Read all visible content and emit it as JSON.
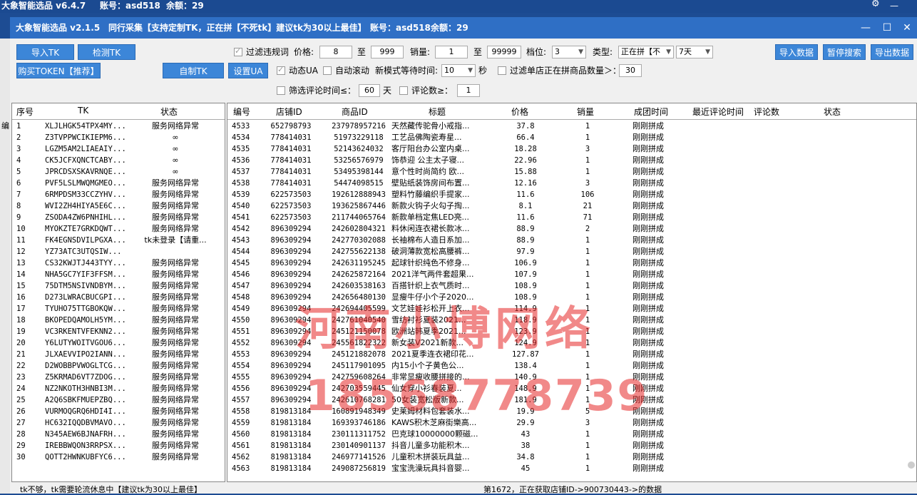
{
  "outer_title": {
    "app": "大象智能选品 v6.4.7",
    "account": "账号：asd518",
    "balance": "余额：29"
  },
  "inner_title": {
    "app": "大象智能选品 v2.1.5",
    "mode": "同行采集【支持定制TK，正在拼【不死tk】建议tk为30以上最佳】",
    "account": "账号：asd518",
    "balance": "余额：29"
  },
  "left_edge_text": "编",
  "buttons": {
    "import_tk": "导入TK",
    "check_tk": "检测TK",
    "buy_token": "购买TOKEN【推荐】",
    "custom_tk": "自制TK",
    "set_ua": "设置UA",
    "import_data": "导入数据",
    "pause_search": "暂停搜索",
    "export_data": "导出数据"
  },
  "filters": {
    "filter_banned": "过滤违规词",
    "price_label": "价格:",
    "price_min": "8",
    "to1": "至",
    "price_max": "999",
    "sales_label": "销量:",
    "sales_min": "1",
    "to2": "至",
    "sales_max": "99999",
    "tier_label": "档位:",
    "tier_value": "3",
    "type_label": "类型:",
    "type_value": "正在拼【不",
    "days_value": "7天",
    "dynamic_ua": "动态UA",
    "auto_scroll": "自动滚动",
    "wait_label": "新模式等待时间:",
    "wait_value": "10",
    "wait_unit": "秒",
    "filter_store": "过滤单店正在拼商品数量＞：",
    "store_count": "30",
    "filter_review_time": "筛选评论时间≤：",
    "review_days": "60",
    "day_unit": "天",
    "review_count_label": "评论数≥：",
    "review_count": "1"
  },
  "tk_table": {
    "headers": [
      "序号",
      "TK",
      "状态"
    ],
    "rows": [
      [
        "1",
        "XLJLHGK54TPX4MY...",
        "服务网络异常"
      ],
      [
        "2",
        "Z3TVPPWCIKIEPM6...",
        "∞"
      ],
      [
        "3",
        "LGZM5AM2LIAEAIY...",
        "∞"
      ],
      [
        "4",
        "CK5JCFXQNCTCABY...",
        "∞"
      ],
      [
        "5",
        "JPRCDSXSKAVRNQE...",
        "∞"
      ],
      [
        "6",
        "PVF5LSLMWQMGMEO...",
        "服务网络异常"
      ],
      [
        "7",
        "6RMPDSM33CCZYHV...",
        "服务网络异常"
      ],
      [
        "8",
        "WVI2ZH4HIYA5E6C...",
        "服务网络异常"
      ],
      [
        "9",
        "ZSODA4ZW6PNHIHL...",
        "服务网络异常"
      ],
      [
        "10",
        "MYOKZTE7GRKDQWT...",
        "服务网络异常"
      ],
      [
        "11",
        "FK4EGNSDVILPGXA...",
        "tk未登录【请重..."
      ],
      [
        "12",
        "YZ73ATC3UTQSIW...",
        ""
      ],
      [
        "13",
        "CS32KWJTJ443TYY...",
        "服务网络异常"
      ],
      [
        "14",
        "NHA5GC7YIF3FFSM...",
        "服务网络异常"
      ],
      [
        "15",
        "75DTM5NSIVNDBYM...",
        "服务网络异常"
      ],
      [
        "16",
        "D273LWRACBUCGPI...",
        "服务网络异常"
      ],
      [
        "17",
        "TYUHO75TTGBOKQW...",
        "服务网络异常"
      ],
      [
        "18",
        "BKOPEDQAMOLH5YM...",
        "服务网络异常"
      ],
      [
        "19",
        "VC3RKENTVFEKNN2...",
        "服务网络异常"
      ],
      [
        "20",
        "Y6LUTYWOITVGOU6...",
        "服务网络异常"
      ],
      [
        "21",
        "JLXAEVVIPO2IANN...",
        "服务网络异常"
      ],
      [
        "22",
        "D2WOBBPVWOGLTCG...",
        "服务网络异常"
      ],
      [
        "23",
        "Z5KRMAD6VT7ZDOG...",
        "服务网络异常"
      ],
      [
        "24",
        "NZ2NKOTH3HNBI3M...",
        "服务网络异常"
      ],
      [
        "25",
        "A2Q6SBKFMUEPZBQ...",
        "服务网络异常"
      ],
      [
        "26",
        "VURMOQGRQ6HDI4I...",
        "服务网络异常"
      ],
      [
        "27",
        "HC632IQQDBVMAVO...",
        "服务网络异常"
      ],
      [
        "28",
        "N345AEW6BJNAFRH...",
        "服务网络异常"
      ],
      [
        "29",
        "IREBBWQON3RRPSX...",
        "服务网络异常"
      ],
      [
        "30",
        "QOTT2HWNKUBFYC6...",
        "服务网络异常"
      ]
    ]
  },
  "goods_table": {
    "headers": [
      "编号",
      "店铺ID",
      "商品ID",
      "标题",
      "价格",
      "销量",
      "成团时间",
      "最近评论时间",
      "评论数",
      "状态"
    ],
    "rows": [
      [
        "4533",
        "652798793",
        "237978957216",
        "天然藏传驼骨小戒指...",
        "37.8",
        "1",
        "刚刚拼成"
      ],
      [
        "4534",
        "778414031",
        "51973229118",
        "工艺品佛陶瓷寿星...",
        "66.4",
        "1",
        "刚刚拼成"
      ],
      [
        "4535",
        "778414031",
        "52143624032",
        "客厅阳台办公室内桌...",
        "18.28",
        "3",
        "刚刚拼成"
      ],
      [
        "4536",
        "778414031",
        "53256576979",
        "饰恭迎 公主太子寝...",
        "22.96",
        "1",
        "刚刚拼成"
      ],
      [
        "4537",
        "778414031",
        "53495398144",
        "意个性时尚简约 欧...",
        "15.88",
        "1",
        "刚刚拼成"
      ],
      [
        "4538",
        "778414031",
        "54474098515",
        "壁贴纸装饰房间布置...",
        "12.16",
        "3",
        "刚刚拼成"
      ],
      [
        "4539",
        "622573503",
        "192612888943",
        "塑料竹藤编织手提家...",
        "11.6",
        "106",
        "刚刚拼成"
      ],
      [
        "4540",
        "622573503",
        "193625867446",
        "新款火钩子火勾子掏...",
        "8.1",
        "21",
        "刚刚拼成"
      ],
      [
        "4541",
        "622573503",
        "211744065764",
        "新款单档定焦LED亮...",
        "11.6",
        "71",
        "刚刚拼成"
      ],
      [
        "4542",
        "896309294",
        "242602804321",
        "料休闲连衣裙长款冰...",
        "88.9",
        "2",
        "刚刚拼成"
      ],
      [
        "4543",
        "896309294",
        "242770302088",
        "长袖棉布人造日系加...",
        "88.9",
        "1",
        "刚刚拼成"
      ],
      [
        "4544",
        "896309294",
        "242755622138",
        "破洞薄款宽松高腰裤...",
        "97.9",
        "1",
        "刚刚拼成"
      ],
      [
        "4545",
        "896309294",
        "242631195245",
        "起球针织纯色不修身...",
        "106.9",
        "1",
        "刚刚拼成"
      ],
      [
        "4546",
        "896309294",
        "242625872164",
        "2021洋气两件套超果...",
        "107.9",
        "1",
        "刚刚拼成"
      ],
      [
        "4547",
        "896309294",
        "242603538163",
        "百搭针织上衣气质时...",
        "108.9",
        "1",
        "刚刚拼成"
      ],
      [
        "4548",
        "896309294",
        "242656480130",
        "显瘦牛仔小个子2020...",
        "108.9",
        "1",
        "刚刚拼成"
      ],
      [
        "4549",
        "896309294",
        "242694405599",
        "文艺娃娃衫松开上衣...",
        "114.9",
        "1",
        "刚刚拼成"
      ],
      [
        "4550",
        "896309294",
        "242761040540",
        "雪纺衬衫夏装2021...",
        "118.9",
        "1",
        "刚刚拼成"
      ],
      [
        "4551",
        "896309294",
        "245121150078",
        "欧洲站韩夏季2021...",
        "123.9",
        "1",
        "刚刚拼成"
      ],
      [
        "4552",
        "896309294",
        "245561822322",
        "新女装V2021新款...",
        "124.9",
        "1",
        "刚刚拼成"
      ],
      [
        "4553",
        "896309294",
        "245121882078",
        "2021夏季连衣裙印花...",
        "127.87",
        "1",
        "刚刚拼成"
      ],
      [
        "4554",
        "896309294",
        "245117901095",
        "内15小个子黄色公...",
        "138.4",
        "1",
        "刚刚拼成"
      ],
      [
        "4555",
        "896309294",
        "242759608264",
        "非常显瘦收腰拼接的...",
        "140.9",
        "1",
        "刚刚拼成"
      ],
      [
        "4556",
        "896309294",
        "242703559445",
        "仙女穿小衫春装夏...",
        "148.9",
        "1",
        "刚刚拼成"
      ],
      [
        "4557",
        "896309294",
        "242610768281",
        "50女装宽松版新款...",
        "181.9",
        "1",
        "刚刚拼成"
      ],
      [
        "4558",
        "819813184",
        "160891948349",
        "史莱姆材料包套装水...",
        "19.9",
        "5",
        "刚刚拼成"
      ],
      [
        "4559",
        "819813184",
        "169393746186",
        "KAWS积木芝麻街樂高...",
        "29.9",
        "3",
        "刚刚拼成"
      ],
      [
        "4560",
        "819813184",
        "230111311752",
        "巴克球10000000颗磁...",
        "43",
        "1",
        "刚刚拼成"
      ],
      [
        "4561",
        "819813184",
        "230140901137",
        "抖音儿童多功能积木...",
        "38",
        "1",
        "刚刚拼成"
      ],
      [
        "4562",
        "819813184",
        "246977141526",
        "儿童积木拼装玩具益...",
        "34.8",
        "1",
        "刚刚拼成"
      ],
      [
        "4563",
        "819813184",
        "249087256819",
        "宝宝洗澡玩具抖音婴...",
        "45",
        "1",
        "刚刚拼成"
      ]
    ]
  },
  "status_bar": {
    "left": "tk不够，tk需要轮流休息中【建议tk为30以上最佳】",
    "right": "第1672，正在获取店铺ID->900730443->的数据"
  },
  "watermark": {
    "line1": "河南小博网络",
    "line2": "18568778739"
  },
  "colors": {
    "title_bar": "#2f6fc5",
    "button": "#3c86d8",
    "watermark": "#e62828"
  }
}
